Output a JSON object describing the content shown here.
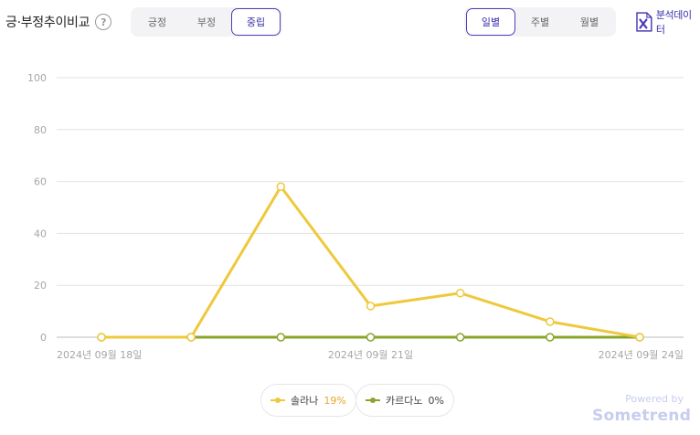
{
  "header": {
    "title": "긍·부정추이비교",
    "help_glyph": "?",
    "sentiment_tabs": [
      "긍정",
      "부정",
      "중립"
    ],
    "sentiment_active": "중립",
    "period_tabs": [
      "일별",
      "주별",
      "월별"
    ],
    "period_active": "일별",
    "export_label": "분석데이터"
  },
  "legend": [
    {
      "name": "솔라나",
      "value": "19%",
      "color": "#efc83c"
    },
    {
      "name": "카르다노",
      "value": "0%",
      "color": "#8aa42a"
    }
  ],
  "footer": {
    "powered": "Powered by",
    "brand": "Sometrend"
  },
  "chart_data": {
    "type": "line",
    "x": [
      "2024-09-18",
      "2024-09-19",
      "2024-09-20",
      "2024-09-21",
      "2024-09-22",
      "2024-09-23",
      "2024-09-24"
    ],
    "x_tick_labels": [
      "2024년 09월 18일",
      "2024년 09월 21일",
      "2024년 09월 24일"
    ],
    "y_ticks": [
      "0",
      "20",
      "40",
      "60",
      "80",
      "100"
    ],
    "ylim": [
      0,
      100
    ],
    "grid": true,
    "series": [
      {
        "name": "솔라나",
        "color": "#efc83c",
        "values": [
          0,
          0,
          58,
          12,
          17,
          6,
          0
        ]
      },
      {
        "name": "카르다노",
        "color": "#8aa42a",
        "values": [
          0,
          0,
          0,
          0,
          0,
          0,
          0
        ]
      }
    ]
  }
}
